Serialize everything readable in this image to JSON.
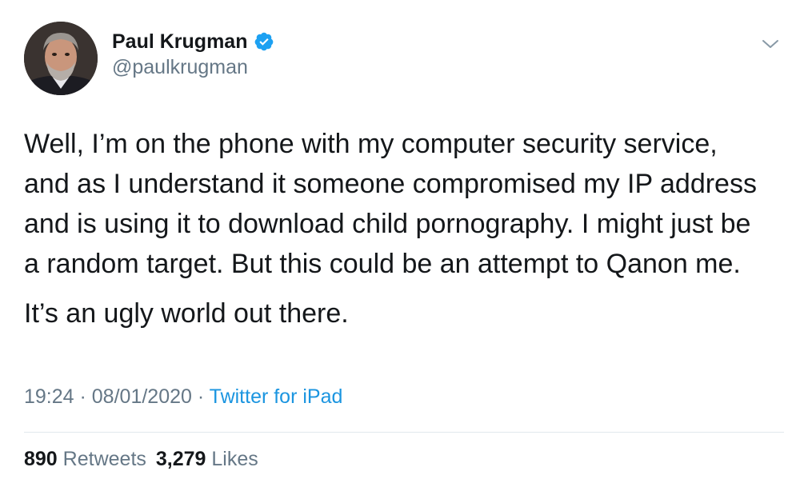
{
  "author": {
    "display_name": "Paul Krugman",
    "handle": "@paulkrugman",
    "verified": true
  },
  "tweet": {
    "paragraph1": "Well, I’m on the phone with my computer security service,\nand as I understand it someone compromised my IP address\nand is using it to download child pornography. I might just be\na random target. But this could be an attempt to Qanon me.",
    "paragraph2": "It’s an ugly world out there."
  },
  "meta": {
    "time": "19:24",
    "separator1": " · ",
    "date": "08/01/2020",
    "separator2": " · ",
    "source": "Twitter for iPad"
  },
  "stats": {
    "retweets_count": "890",
    "retweets_label": "Retweets",
    "likes_count": "3,279",
    "likes_label": "Likes"
  },
  "colors": {
    "text": "#14171a",
    "secondary": "#657786",
    "link": "#1b95e0",
    "verified": "#1da1f2",
    "divider": "#e1e8ed"
  },
  "icons": {
    "verified": "verified-badge-icon",
    "menu": "chevron-down-icon"
  }
}
